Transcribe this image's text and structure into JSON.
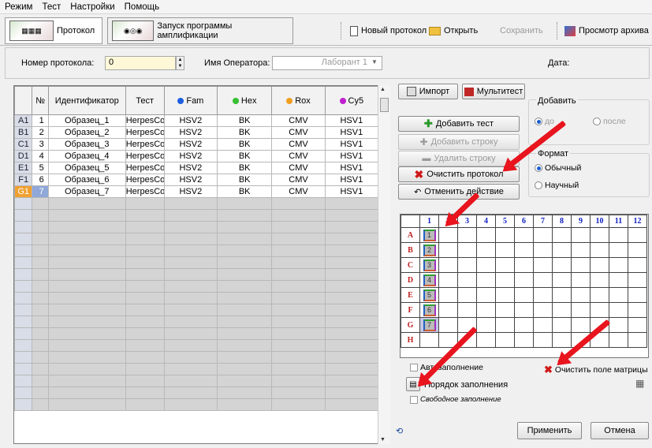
{
  "menu": [
    "Режим",
    "Тест",
    "Настройки",
    "Помощь"
  ],
  "tabs": {
    "protocol": "Протокол",
    "run": "Запуск программы амплификации"
  },
  "toolbar": {
    "new": "Новый протокол",
    "open": "Открыть",
    "save": "Сохранить",
    "archive": "Просмотр архива"
  },
  "info": {
    "protocol_label": "Номер протокола:",
    "protocol_value": "0",
    "operator_label": "Имя Оператора:",
    "operator_value": "Лаборант 1",
    "date_label": "Дата:"
  },
  "table": {
    "headers": [
      "№",
      "Идентификатор",
      "Тест",
      "Fam",
      "Hex",
      "Rox",
      "Cy5"
    ],
    "dot_colors": {
      "Fam": "#1e5fe0",
      "Hex": "#36c030",
      "Rox": "#f0a020",
      "Cy5": "#c020d0"
    },
    "rows": [
      {
        "well": "A1",
        "n": "1",
        "id": "Образец_1",
        "test": "HerpesCom",
        "fam": "HSV2",
        "hex": "BK",
        "rox": "CMV",
        "cy5": "HSV1"
      },
      {
        "well": "B1",
        "n": "2",
        "id": "Образец_2",
        "test": "HerpesCom",
        "fam": "HSV2",
        "hex": "BK",
        "rox": "CMV",
        "cy5": "HSV1"
      },
      {
        "well": "C1",
        "n": "3",
        "id": "Образец_3",
        "test": "HerpesCom",
        "fam": "HSV2",
        "hex": "BK",
        "rox": "CMV",
        "cy5": "HSV1"
      },
      {
        "well": "D1",
        "n": "4",
        "id": "Образец_4",
        "test": "HerpesCom",
        "fam": "HSV2",
        "hex": "BK",
        "rox": "CMV",
        "cy5": "HSV1"
      },
      {
        "well": "E1",
        "n": "5",
        "id": "Образец_5",
        "test": "HerpesCom",
        "fam": "HSV2",
        "hex": "BK",
        "rox": "CMV",
        "cy5": "HSV1"
      },
      {
        "well": "F1",
        "n": "6",
        "id": "Образец_6",
        "test": "HerpesCom",
        "fam": "HSV2",
        "hex": "BK",
        "rox": "CMV",
        "cy5": "HSV1"
      },
      {
        "well": "G1",
        "n": "7",
        "id": "Образец_7",
        "test": "HerpesCom",
        "fam": "HSV2",
        "hex": "BK",
        "rox": "CMV",
        "cy5": "HSV1"
      }
    ],
    "selected_row": 6,
    "empty_rows": 18
  },
  "buttons": {
    "import": "Импорт",
    "multitest": "Мультитест",
    "add_test": "Добавить тест",
    "add_row": "Добавить строку",
    "delete_row": "Удалить строку",
    "clear_protocol": "Очистить протокол",
    "undo": "Отменить действие",
    "apply": "Применить",
    "cancel": "Отмена"
  },
  "add_group": {
    "title": "Добавить",
    "before": "до",
    "after": "после"
  },
  "format_group": {
    "title": "Формат",
    "normal": "Обычный",
    "scientific": "Научный"
  },
  "plate": {
    "cols": [
      "1",
      "2",
      "3",
      "4",
      "5",
      "6",
      "7",
      "8",
      "9",
      "10",
      "11",
      "12"
    ],
    "rows": [
      "A",
      "B",
      "C",
      "D",
      "E",
      "F",
      "G",
      "H"
    ],
    "filled": [
      "1",
      "2",
      "3",
      "4",
      "5",
      "6",
      "7"
    ]
  },
  "matrix": {
    "autofill": "Автозаполнение",
    "clear": "Очистить поле матрицы",
    "fill_order": "Порядок заполнения",
    "free_fill": "Свободное заполнение"
  }
}
